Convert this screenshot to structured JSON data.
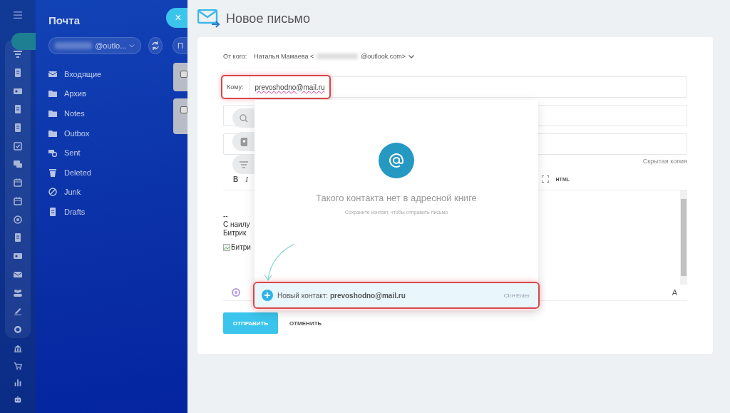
{
  "mail_panel": {
    "title": "Почта",
    "account": "@outlo...",
    "folders": [
      {
        "label": "Входящие",
        "kind": "inbox"
      },
      {
        "label": "Архив",
        "kind": "folder"
      },
      {
        "label": "Notes",
        "kind": "folder"
      },
      {
        "label": "Outbox",
        "kind": "folder"
      },
      {
        "label": "Sent",
        "kind": "sent"
      },
      {
        "label": "Deleted",
        "kind": "trash"
      },
      {
        "label": "Junk",
        "kind": "junk"
      },
      {
        "label": "Drafts",
        "kind": "drafts"
      }
    ],
    "filter_button": "П",
    "message_cards": [
      {
        "checked": false
      },
      {
        "checked": false
      }
    ]
  },
  "close_button": "×",
  "compose": {
    "title": "Новое письмо",
    "from_label": "От кого:",
    "from_name": "Наталья Мамаева <",
    "from_email": "@outlook.com>",
    "to_label": "Кому:",
    "to_value": "prevoshodno@mail.ru",
    "bcc_link": "Скрытая копия",
    "toolbar": [
      "B",
      "I",
      "HTML"
    ],
    "body_lines": [
      "--",
      "С наилу",
      "Битрик"
    ],
    "image_alt": "Битри",
    "font_button": "A",
    "send_button": "ОТПРАВИТЬ",
    "cancel_button": "ОТМЕНИТЬ"
  },
  "contact_popup": {
    "message": "Такого контакта нет в адресной книге",
    "hint": "Сохраните контакт, чтобы отправить письмо",
    "new_contact": "Новый контакт: **prevoshodno@mail.ru**",
    "shortcut": "Ctrl+Enter"
  }
}
